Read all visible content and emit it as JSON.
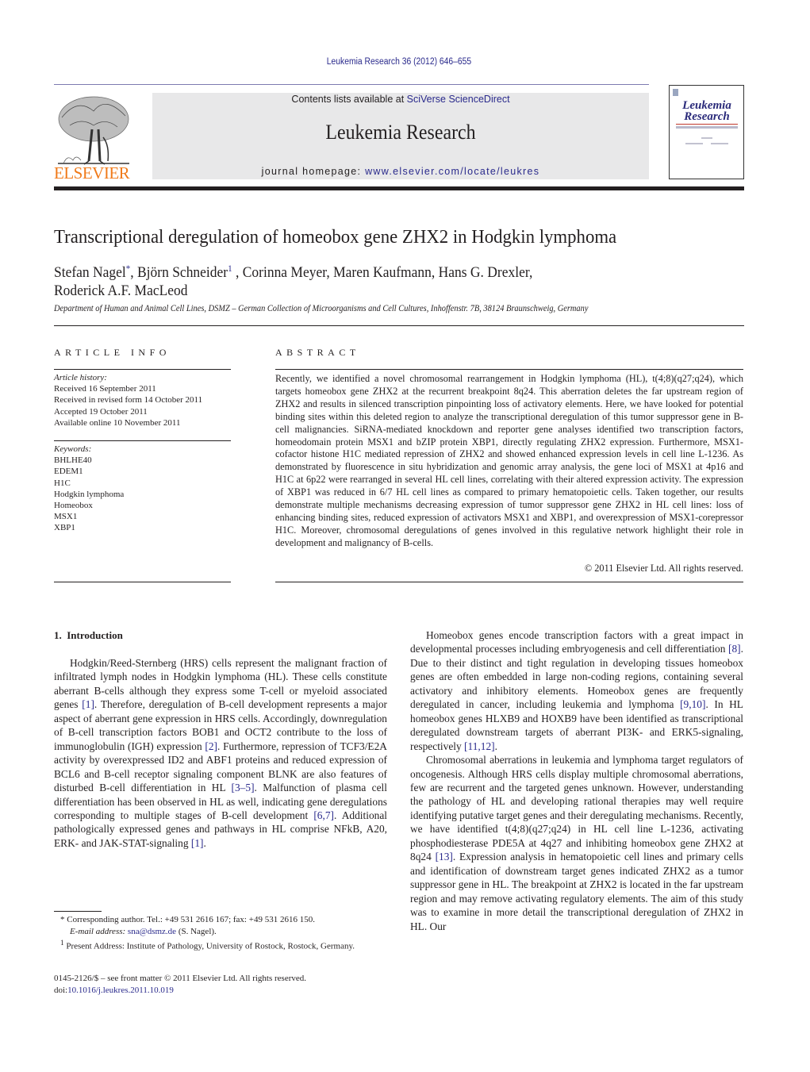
{
  "header": {
    "citation": "Leukemia Research 36 (2012) 646–655",
    "contents_prefix": "Contents lists available at ",
    "contents_link": "SciVerse ScienceDirect",
    "journal_name": "Leukemia Research",
    "homepage_prefix": "journal homepage: ",
    "homepage_link": "www.elsevier.com/locate/leukres",
    "publisher_logo_text": "ELSEVIER",
    "cover": {
      "title_line1": "Leukemia",
      "title_line2": "Research"
    }
  },
  "article": {
    "title": "Transcriptional deregulation of homeobox gene ZHX2 in Hodgkin lymphoma",
    "authors": [
      {
        "name": "Stefan Nagel",
        "mark": "*"
      },
      {
        "name": "Björn Schneider",
        "mark": "1"
      },
      {
        "name": "Corinna Meyer",
        "mark": ""
      },
      {
        "name": "Maren Kaufmann",
        "mark": ""
      },
      {
        "name": "Hans G. Drexler",
        "mark": ""
      },
      {
        "name": "Roderick A.F. MacLeod",
        "mark": ""
      }
    ],
    "affiliation": "Department of Human and Animal Cell Lines, DSMZ – German Collection of Microorganisms and Cell Cultures, Inhoffenstr. 7B, 38124 Braunschweig, Germany"
  },
  "article_info": {
    "heading": "ARTICLE INFO",
    "history_label": "Article history:",
    "history": [
      "Received 16 September 2011",
      "Received in revised form 14 October 2011",
      "Accepted 19 October 2011",
      "Available online 10 November 2011"
    ],
    "keywords_label": "Keywords:",
    "keywords": [
      "BHLHE40",
      "EDEM1",
      "H1C",
      "Hodgkin lymphoma",
      "Homeobox",
      "MSX1",
      "XBP1"
    ]
  },
  "abstract": {
    "heading": "ABSTRACT",
    "text": "Recently, we identified a novel chromosomal rearrangement in Hodgkin lymphoma (HL), t(4;8)(q27;q24), which targets homeobox gene ZHX2 at the recurrent breakpoint 8q24. This aberration deletes the far upstream region of ZHX2 and results in silenced transcription pinpointing loss of activatory elements. Here, we have looked for potential binding sites within this deleted region to analyze the transcriptional deregulation of this tumor suppressor gene in B-cell malignancies. SiRNA-mediated knockdown and reporter gene analyses identified two transcription factors, homeodomain protein MSX1 and bZIP protein XBP1, directly regulating ZHX2 expression. Furthermore, MSX1-cofactor histone H1C mediated repression of ZHX2 and showed enhanced expression levels in cell line L-1236. As demonstrated by fluorescence in situ hybridization and genomic array analysis, the gene loci of MSX1 at 4p16 and H1C at 6p22 were rearranged in several HL cell lines, correlating with their altered expression activity. The expression of XBP1 was reduced in 6/7 HL cell lines as compared to primary hematopoietic cells. Taken together, our results demonstrate multiple mechanisms decreasing expression of tumor suppressor gene ZHX2 in HL cell lines: loss of enhancing binding sites, reduced expression of activators MSX1 and XBP1, and overexpression of MSX1-corepressor H1C. Moreover, chromosomal deregulations of genes involved in this regulative network highlight their role in development and malignancy of B-cells.",
    "copyright": "© 2011 Elsevier Ltd. All rights reserved."
  },
  "introduction": {
    "heading": "1.  Introduction",
    "paragraphs": [
      [
        {
          "t": "Hodgkin/Reed-Sternberg (HRS) cells represent the malignant fraction of infiltrated lymph nodes in Hodgkin lymphoma (HL). These cells constitute aberrant B-cells although they express some T-cell or myeloid associated genes "
        },
        {
          "ref": "[1]"
        },
        {
          "t": ". Therefore, deregulation of B-cell development represents a major aspect of aberrant gene expression in HRS cells. Accordingly, downregulation of B-cell transcription factors BOB1 and OCT2 contribute to the loss of immunoglobulin (IGH) expression "
        },
        {
          "ref": "[2]"
        },
        {
          "t": ". Furthermore, repression of TCF3/E2A activity by overexpressed ID2 and ABF1 proteins and reduced expression of BCL6 and B-cell receptor signaling component BLNK are also features of disturbed B-cell differentiation in HL "
        },
        {
          "ref": "[3–5]"
        },
        {
          "t": ". Malfunction of plasma cell differentiation has been observed in HL as well, indicating gene deregulations corresponding to multiple stages of B-cell development "
        },
        {
          "ref": "[6,7]"
        },
        {
          "t": ". Additional pathologically expressed genes and pathways in HL comprise NFkB, A20, ERK- and JAK-STAT-signaling "
        },
        {
          "ref": "[1]"
        },
        {
          "t": "."
        }
      ],
      [
        {
          "t": "Homeobox genes encode transcription factors with a great impact in developmental processes including embryogenesis and cell differentiation "
        },
        {
          "ref": "[8]"
        },
        {
          "t": ". Due to their distinct and tight regulation in developing tissues homeobox genes are often embedded in large non-coding regions, containing several activatory and inhibitory elements. Homeobox genes are frequently deregulated in cancer, including leukemia and lymphoma "
        },
        {
          "ref": "[9,10]"
        },
        {
          "t": ". In HL homeobox genes HLXB9 and HOXB9 have been identified as transcriptional deregulated downstream targets of aberrant PI3K- and ERK5-signaling, respectively "
        },
        {
          "ref": "[11,12]"
        },
        {
          "t": "."
        }
      ],
      [
        {
          "t": "Chromosomal aberrations in leukemia and lymphoma target regulators of oncogenesis. Although HRS cells display multiple chromosomal aberrations, few are recurrent and the targeted genes unknown. However, understanding the pathology of HL and developing rational therapies may well require identifying putative target genes and their deregulating mechanisms. Recently, we have identified t(4;8)(q27;q24) in HL cell line L-1236, activating phosphodiesterase PDE5A at 4q27 and inhibiting homeobox gene ZHX2 at 8q24 "
        },
        {
          "ref": "[13]"
        },
        {
          "t": ". Expression analysis in hematopoietic cell lines and primary cells and identification of downstream target genes indicated ZHX2 as a tumor suppressor gene in HL. The breakpoint at ZHX2 is located in the far upstream region and may remove activating regulatory elements. The aim of this study was to examine in more detail the transcriptional deregulation of ZHX2 in HL. Our"
        }
      ]
    ]
  },
  "footnotes": {
    "corresponding_mark": "*",
    "corresponding_text": "Corresponding author. Tel.: +49 531 2616 167; fax: +49 531 2616 150.",
    "email_label": "E-mail address:",
    "email": "sna@dsmz.de",
    "email_suffix": "(S. Nagel).",
    "present_mark": "1",
    "present_text": "Present Address: Institute of Pathology, University of Rostock, Rostock, Germany."
  },
  "frontmatter": {
    "issn_line": "0145-2126/$ – see front matter © 2011 Elsevier Ltd. All rights reserved.",
    "doi_prefix": "doi:",
    "doi": "10.1016/j.leukres.2011.10.019"
  },
  "colors": {
    "link": "#2a2a8c",
    "elsevier_orange": "#f07a1a",
    "banner_gray": "#e8e8e9",
    "text": "#231f20"
  }
}
